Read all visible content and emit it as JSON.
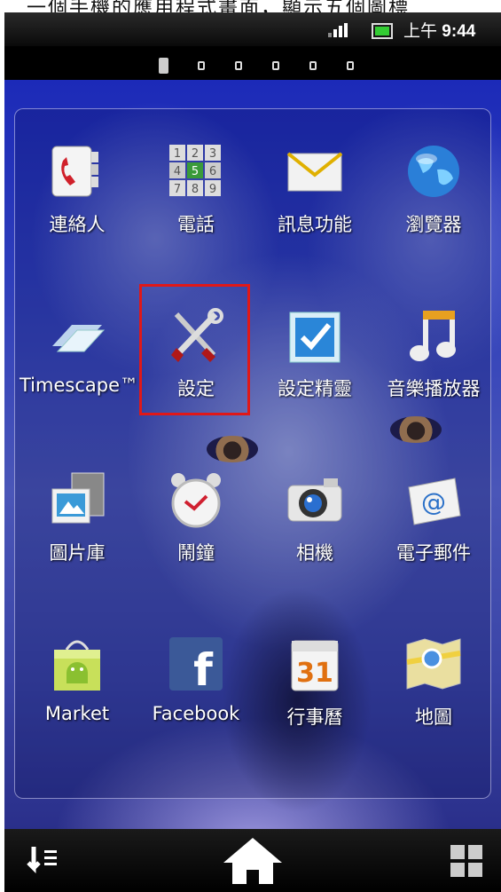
{
  "caption": "一個手機的應用程式畫面，顯示五個圖標",
  "status": {
    "time_prefix": "上午",
    "time": "9:44",
    "signal-icon": "signal-icon",
    "battery-icon": "battery-icon"
  },
  "pager": {
    "pages": 6,
    "active": 1
  },
  "apps": [
    {
      "label": "連絡人",
      "icon": "contacts-icon"
    },
    {
      "label": "電話",
      "icon": "phone-dialpad-icon"
    },
    {
      "label": "訊息功能",
      "icon": "messaging-envelope-icon"
    },
    {
      "label": "瀏覽器",
      "icon": "browser-globe-icon"
    },
    {
      "label": "Timescape™",
      "icon": "timescape-icon"
    },
    {
      "label": "設定",
      "icon": "settings-wrench-icon"
    },
    {
      "label": "設定精靈",
      "icon": "setup-wizard-check-icon"
    },
    {
      "label": "音樂播放器",
      "icon": "music-note-icon"
    },
    {
      "label": "圖片庫",
      "icon": "gallery-icon"
    },
    {
      "label": "鬧鐘",
      "icon": "alarm-clock-icon"
    },
    {
      "label": "相機",
      "icon": "camera-icon"
    },
    {
      "label": "電子郵件",
      "icon": "email-icon"
    },
    {
      "label": "Market",
      "icon": "market-bag-icon"
    },
    {
      "label": "Facebook",
      "icon": "facebook-icon"
    },
    {
      "label": "行事曆",
      "icon": "calendar-icon"
    },
    {
      "label": "地圖",
      "icon": "maps-icon"
    }
  ],
  "calendar_day": "31",
  "facebook_letter": "f",
  "navbar": {
    "left": "sort-list-icon",
    "center": "home-icon",
    "right": "grid-apps-icon"
  },
  "colors": {
    "highlight": "#e01818"
  }
}
